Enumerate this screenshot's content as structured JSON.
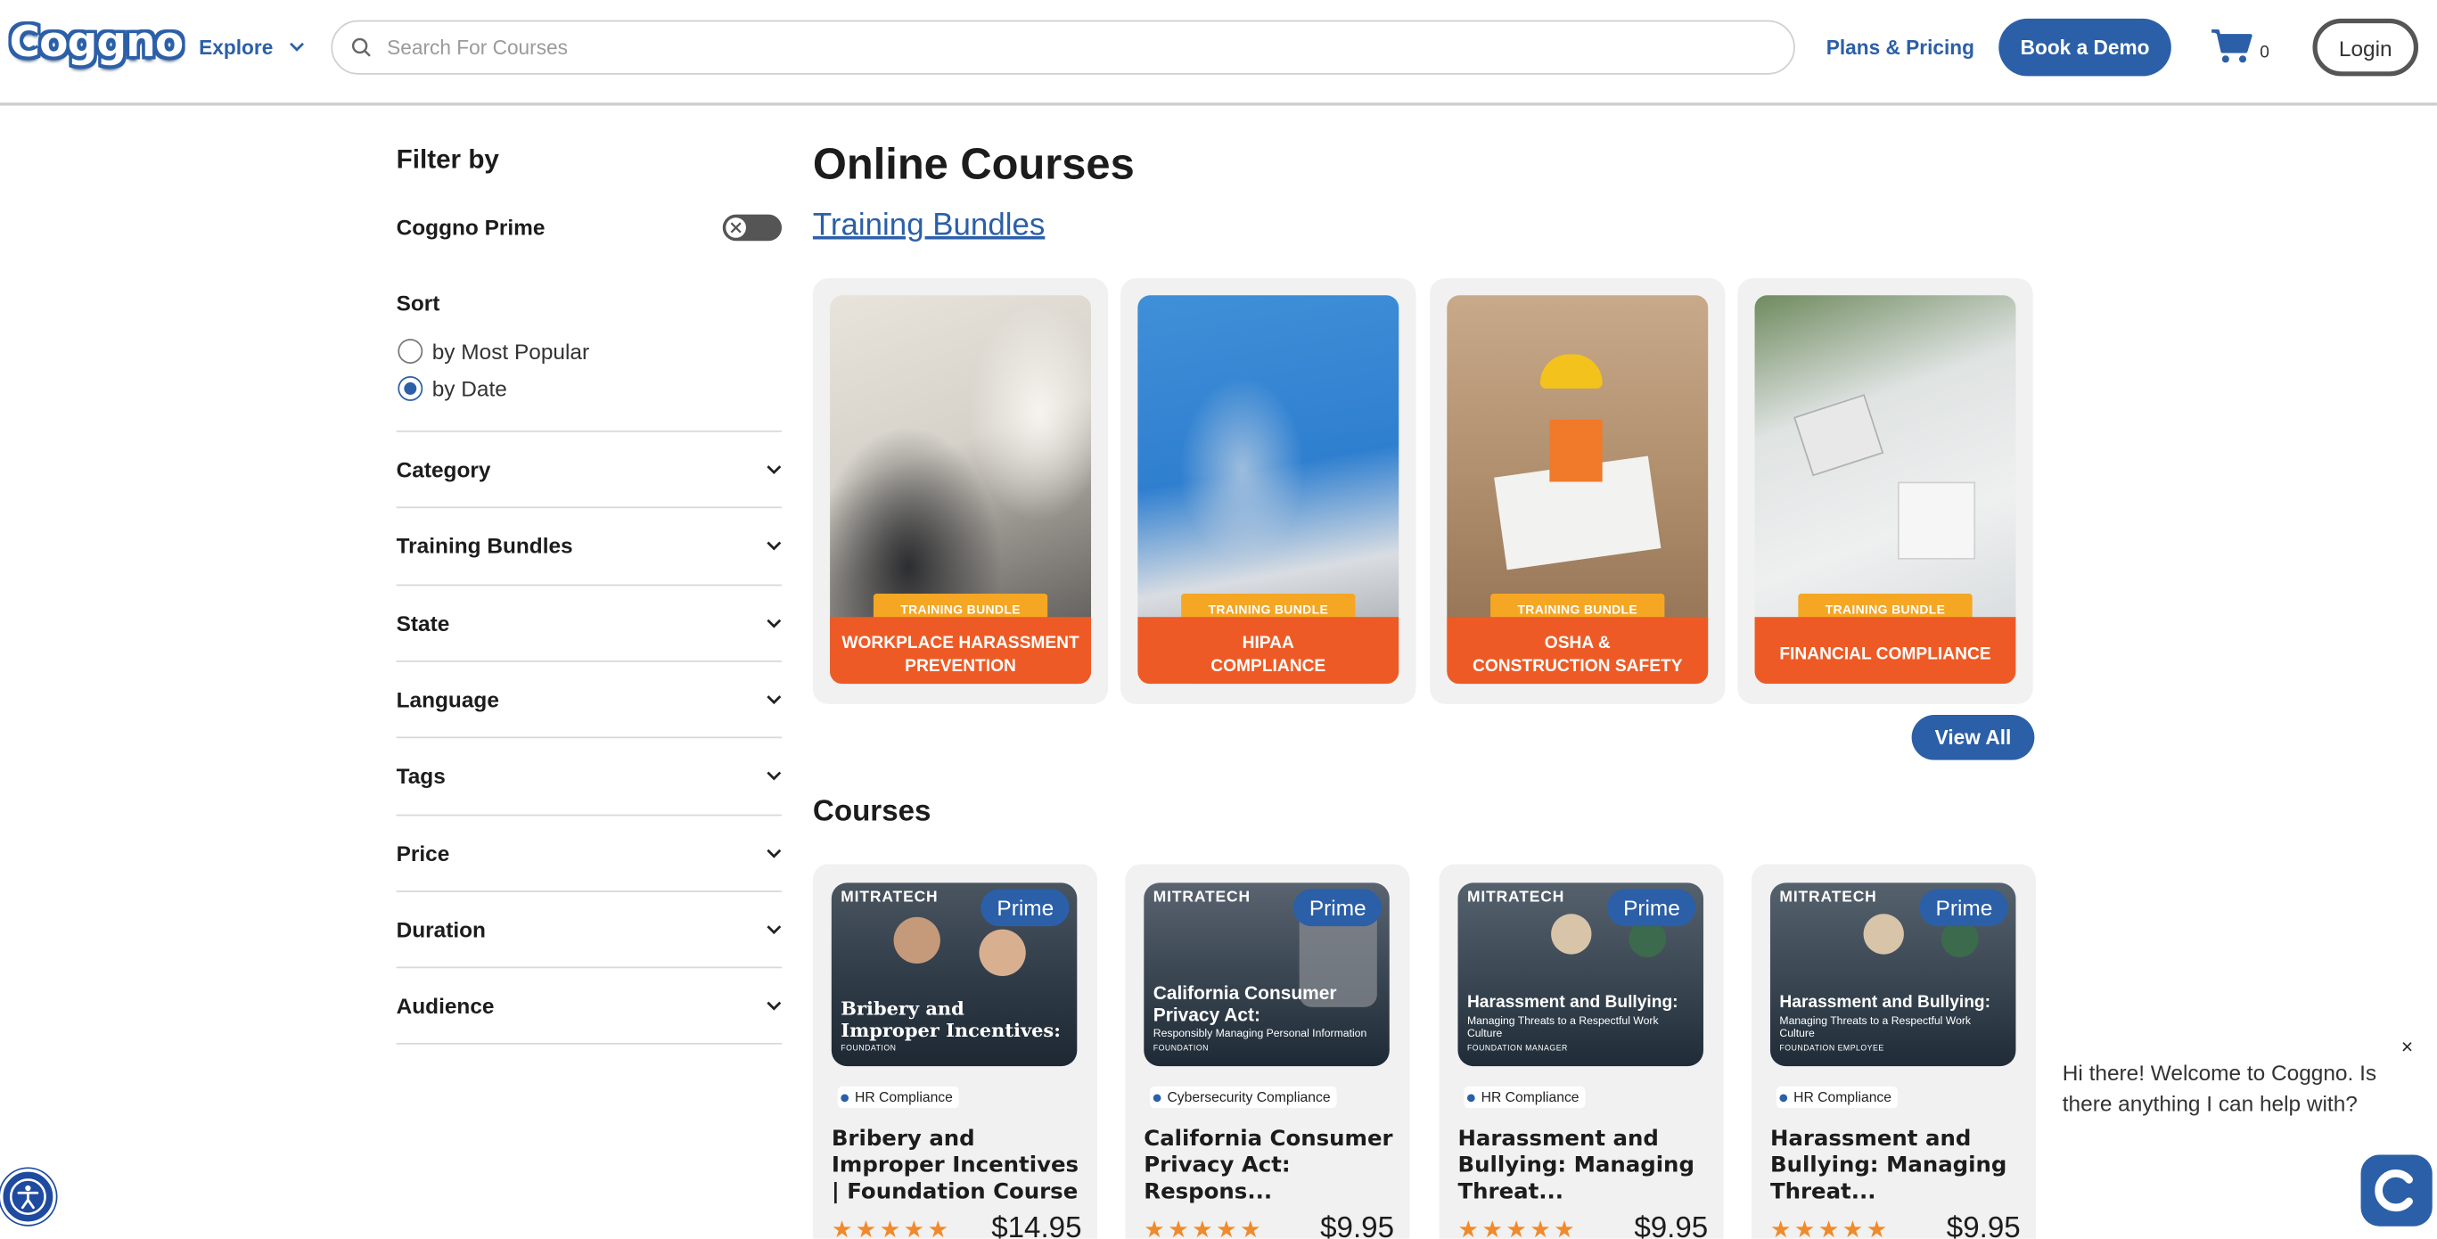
{
  "header": {
    "logo": "Coggno",
    "explore_label": "Explore",
    "search_placeholder": "Search For Courses",
    "plans_label": "Plans & Pricing",
    "demo_label": "Book a Demo",
    "cart_count": "0",
    "login_label": "Login"
  },
  "sidebar": {
    "title": "Filter by",
    "prime_label": "Coggno Prime",
    "prime_enabled": false,
    "sort_title": "Sort",
    "sort_options": [
      {
        "label": "by Most Popular",
        "checked": false
      },
      {
        "label": "by Date",
        "checked": true
      }
    ],
    "facets": [
      "Category",
      "Training Bundles",
      "State",
      "Language",
      "Tags",
      "Price",
      "Duration",
      "Audience"
    ]
  },
  "main": {
    "title": "Online Courses",
    "bundles_link": "Training Bundles",
    "bundle_ribbon": "TRAINING BUNDLE",
    "bundles": [
      {
        "line1": "WORKPLACE HARASSMENT",
        "line2": "PREVENTION"
      },
      {
        "line1": "HIPAA",
        "line2": "COMPLIANCE"
      },
      {
        "line1": "OSHA &",
        "line2": "CONSTRUCTION SAFETY"
      },
      {
        "line1": "FINANCIAL COMPLIANCE",
        "line2": ""
      }
    ],
    "view_all_label": "View All",
    "courses_title": "Courses",
    "courses": [
      {
        "brand": "MITRATECH",
        "badge": "Prime",
        "img_title": "Bribery and Improper Incentives:",
        "img_sub": "",
        "img_tag": "FOUNDATION",
        "category": "HR Compliance",
        "name": "Bribery and Improper Incentives | Foundation Course",
        "price": "$14.95"
      },
      {
        "brand": "MITRATECH",
        "badge": "Prime",
        "img_title": "California Consumer Privacy Act:",
        "img_sub": "Responsibly Managing Personal Information",
        "img_tag": "FOUNDATION",
        "category": "Cybersecurity Compliance",
        "name": "California Consumer Privacy Act: Respons...",
        "price": "$9.95"
      },
      {
        "brand": "MITRATECH",
        "badge": "Prime",
        "img_title": "Harassment and Bullying:",
        "img_sub": "Managing Threats to a Respectful Work Culture",
        "img_tag": "FOUNDATION MANAGER",
        "category": "HR Compliance",
        "name": "Harassment and Bullying: Managing Threat...",
        "price": "$9.95"
      },
      {
        "brand": "MITRATECH",
        "badge": "Prime",
        "img_title": "Harassment and Bullying:",
        "img_sub": "Managing Threats to a Respectful Work Culture",
        "img_tag": "FOUNDATION EMPLOYEE",
        "category": "HR Compliance",
        "name": "Harassment and Bullying: Managing Threat...",
        "price": "$9.95"
      }
    ]
  },
  "chat": {
    "message": "Hi there! Welcome to Coggno. Is there anything I can help with?",
    "close_glyph": "×"
  },
  "colors": {
    "brand_blue": "#2b5fa8",
    "bundle_orange": "#ee5a25",
    "ribbon_gold": "#f5a623",
    "star_orange": "#f08a2a"
  },
  "icons": [
    "search-icon",
    "chevron-down-icon",
    "cart-icon",
    "accessibility-icon",
    "chat-icon",
    "star-icon",
    "close-icon"
  ]
}
